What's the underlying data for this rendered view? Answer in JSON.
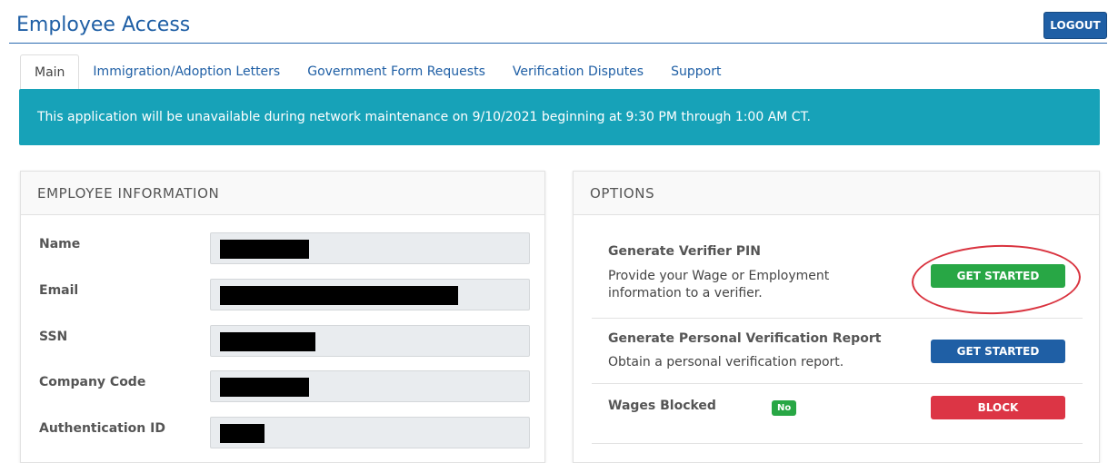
{
  "header": {
    "title": "Employee Access",
    "logout_label": "LOGOUT"
  },
  "tabs": [
    {
      "label": "Main"
    },
    {
      "label": "Immigration/Adoption Letters"
    },
    {
      "label": "Government Form Requests"
    },
    {
      "label": "Verification Disputes"
    },
    {
      "label": "Support"
    }
  ],
  "alert": {
    "text": "This application will be unavailable during network maintenance on 9/10/2021 beginning at 9:30 PM through 1:00 AM CT."
  },
  "employee_panel": {
    "heading": "EMPLOYEE INFORMATION",
    "fields": [
      {
        "label": "Name",
        "value": ""
      },
      {
        "label": "Email",
        "value": ""
      },
      {
        "label": "SSN",
        "value": ""
      },
      {
        "label": "Company Code",
        "value": ""
      },
      {
        "label": "Authentication ID",
        "value": ""
      }
    ]
  },
  "options_panel": {
    "heading": "OPTIONS",
    "items": [
      {
        "title": "Generate Verifier PIN",
        "description": "Provide your Wage or Employment information to a verifier.",
        "button": "GET STARTED",
        "button_color": "#28a745"
      },
      {
        "title": "Generate Personal Verification Report",
        "description": "Obtain a personal verification report.",
        "button": "GET STARTED",
        "button_color": "#1f5fa5"
      },
      {
        "title": "Wages Blocked",
        "badge": "No",
        "button": "BLOCK",
        "button_color": "#dc3545"
      }
    ]
  },
  "colors": {
    "primary": "#1f5fa5",
    "alert_bg": "#17a2b8",
    "success": "#28a745",
    "danger": "#dc3545",
    "annotation": "#d9333f"
  }
}
